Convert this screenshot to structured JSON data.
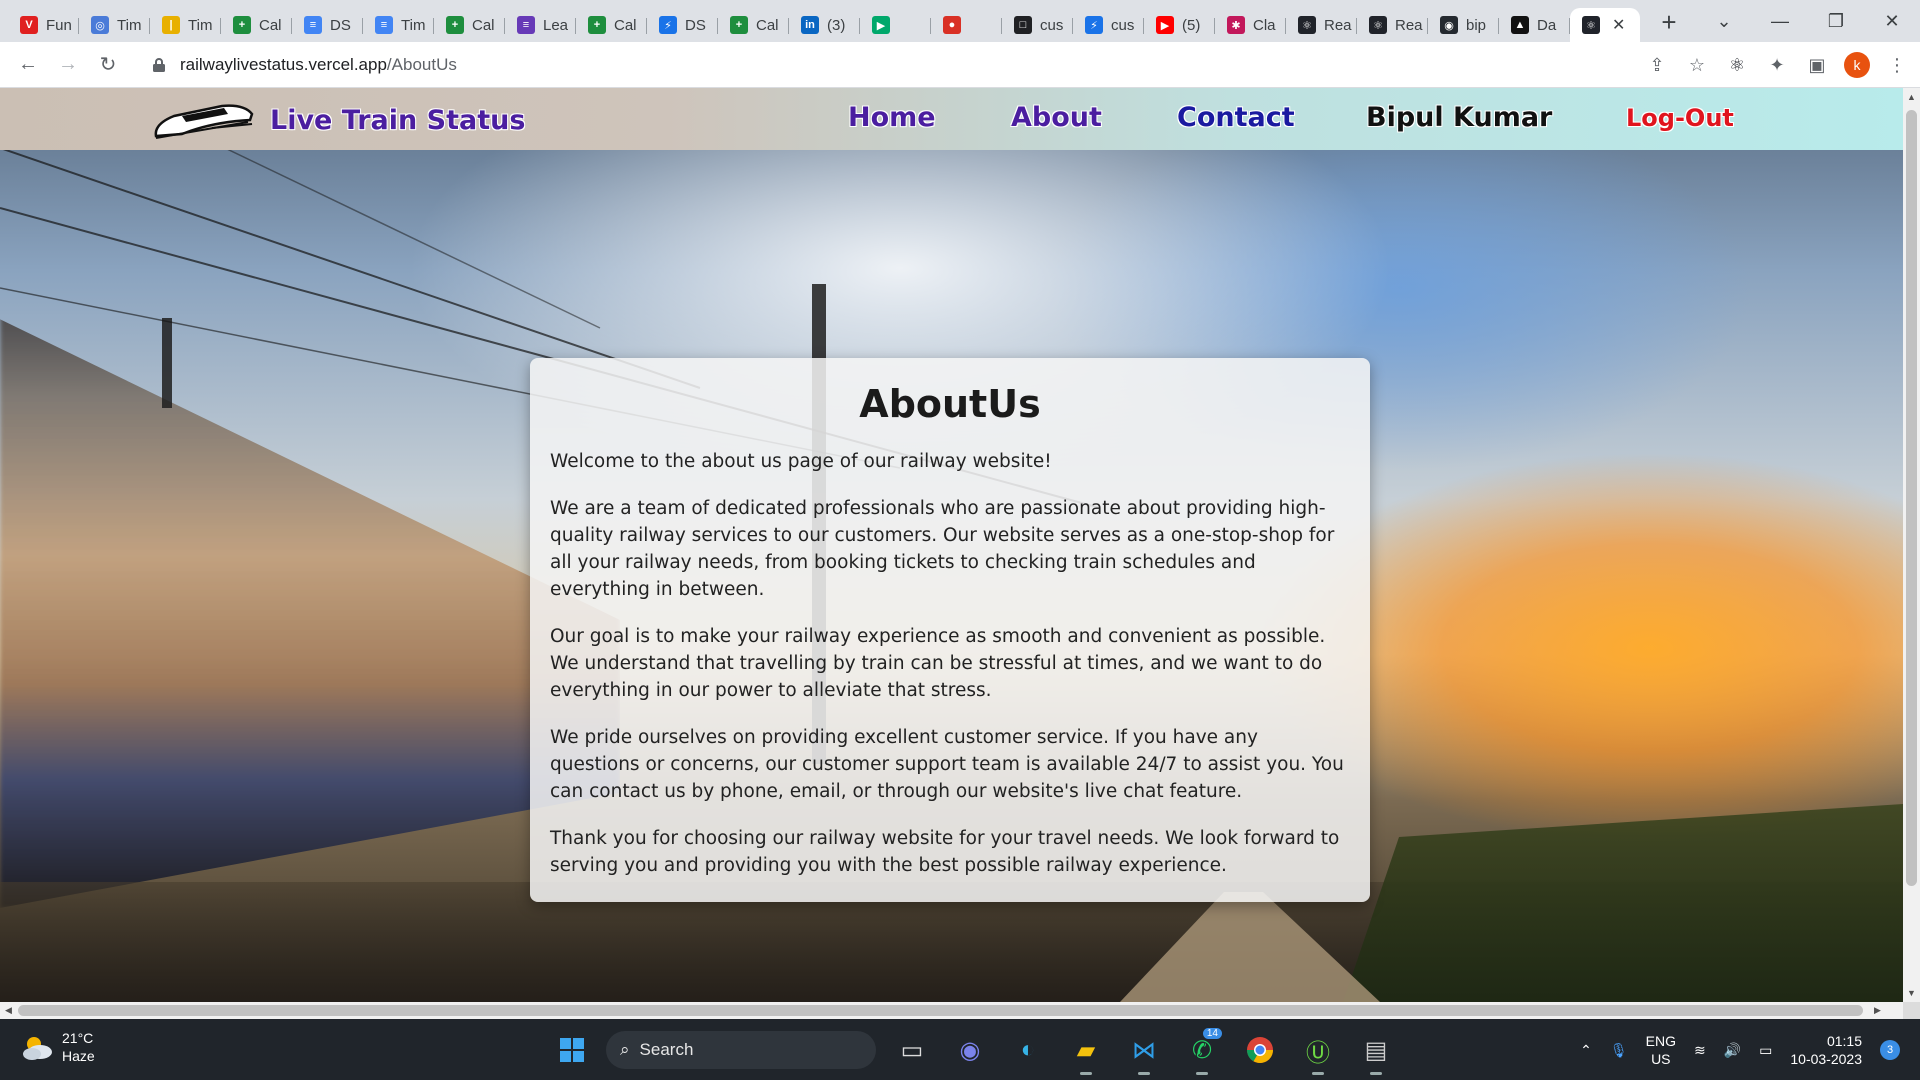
{
  "browser": {
    "tabs": [
      {
        "title": "Fun",
        "color": "#e02020",
        "glyph": "V"
      },
      {
        "title": "Tim",
        "color": "#4a7bd8",
        "glyph": "◎"
      },
      {
        "title": "Tim",
        "color": "#e8b000",
        "glyph": "|"
      },
      {
        "title": "Cal",
        "color": "#1e8e3e",
        "glyph": "+"
      },
      {
        "title": "DS",
        "color": "#4285f4",
        "glyph": "≡"
      },
      {
        "title": "Tim",
        "color": "#4285f4",
        "glyph": "≡"
      },
      {
        "title": "Cal",
        "color": "#1e8e3e",
        "glyph": "+"
      },
      {
        "title": "Lea",
        "color": "#673ab7",
        "glyph": "≡"
      },
      {
        "title": "Cal",
        "color": "#1e8e3e",
        "glyph": "+"
      },
      {
        "title": "DS",
        "color": "#1a73e8",
        "glyph": "⚡"
      },
      {
        "title": "Cal",
        "color": "#1e8e3e",
        "glyph": "+"
      },
      {
        "title": "(3)",
        "color": "#0a66c2",
        "glyph": "in"
      },
      {
        "title": "",
        "color": "#00a86b",
        "glyph": "▶"
      },
      {
        "title": "",
        "color": "#d93025",
        "glyph": "●"
      },
      {
        "title": "cus",
        "color": "#202124",
        "glyph": "□"
      },
      {
        "title": "cus",
        "color": "#1a73e8",
        "glyph": "⚡"
      },
      {
        "title": "(5)",
        "color": "#ff0000",
        "glyph": "▶"
      },
      {
        "title": "Cla",
        "color": "#c2185b",
        "glyph": "✱"
      },
      {
        "title": "Rea",
        "color": "#20232a",
        "glyph": "⚛"
      },
      {
        "title": "Rea",
        "color": "#20232a",
        "glyph": "⚛"
      },
      {
        "title": "bip",
        "color": "#24292f",
        "glyph": "◉"
      },
      {
        "title": "Da",
        "color": "#111111",
        "glyph": "▲"
      }
    ],
    "active_tab": {
      "title": "",
      "glyph": "⚛",
      "color": "#20232a",
      "close": "✕"
    },
    "new_tab": "+",
    "url_host": "railwaylivestatus.vercel.app",
    "url_path": "/AboutUs",
    "profile_initial": "k"
  },
  "site": {
    "brand": "Live Train Status",
    "nav": {
      "home": "Home",
      "about": "About",
      "contact": "Contact",
      "user": "Bipul Kumar",
      "logout": "Log-Out"
    },
    "about": {
      "heading": "AboutUs",
      "paragraphs": [
        "Welcome to the about us page of our railway website!",
        "We are a team of dedicated professionals who are passionate about providing high-quality railway services to our customers. Our website serves as a one-stop-shop for all your railway needs, from booking tickets to checking train schedules and everything in between.",
        "Our goal is to make your railway experience as smooth and convenient as possible. We understand that travelling by train can be stressful at times, and we want to do everything in our power to alleviate that stress.",
        "We pride ourselves on providing excellent customer service. If you have any questions or concerns, our customer support team is available 24/7 to assist you. You can contact us by phone, email, or through our website's live chat feature.",
        "Thank you for choosing our railway website for your travel needs. We look forward to serving you and providing you with the best possible railway experience."
      ]
    }
  },
  "taskbar": {
    "weather_temp": "21°C",
    "weather_desc": "Haze",
    "search_label": "Search",
    "whatsapp_badge": "14",
    "lang_line1": "ENG",
    "lang_line2": "US",
    "time": "01:15",
    "date": "10-03-2023",
    "notifications": "3"
  },
  "colors": {
    "brand": "#4b1ea0",
    "contact": "#1a1aa0",
    "logout": "#e0141e"
  }
}
